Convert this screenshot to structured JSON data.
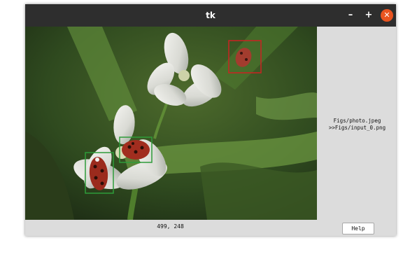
{
  "window": {
    "title": "tk",
    "controls": {
      "minimize": "–",
      "maximize": "+",
      "close": "✕"
    }
  },
  "side_panel": {
    "path_line_1": "Figs/photo.jpeg",
    "path_line_2": ">>Figs/input_0.png"
  },
  "status": {
    "coordinates": "499, 248",
    "help_label": "Help"
  },
  "annotations": [
    {
      "name": "red-detection-box",
      "color": "#cc2222"
    },
    {
      "name": "green-detection-box-1",
      "color": "#2e9c3a"
    },
    {
      "name": "green-detection-box-2",
      "color": "#2e9c3a"
    }
  ],
  "colors": {
    "titlebar": "#2e2e2e",
    "close_button": "#e95420",
    "window_bg": "#dcdcdc"
  }
}
